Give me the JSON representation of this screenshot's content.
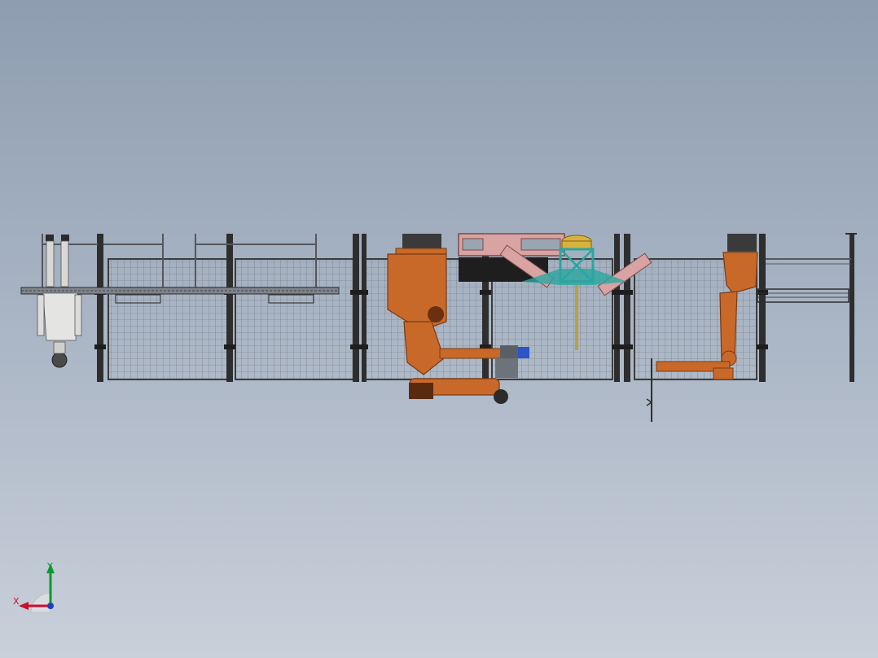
{
  "view": {
    "description_free": true,
    "background_top": "#8e9db0",
    "background_bottom": "#c9d0da"
  },
  "colors": {
    "fence": "#3c3c3c",
    "mesh": "#6b6f75",
    "robot": "#c8692a",
    "robot_dark": "#7a3a12",
    "table": "#2aa6a0",
    "pink": "#d9a3a3",
    "yellow": "#d8b23c",
    "blue": "#2a55c8"
  },
  "triad": {
    "x_label": "X",
    "y_label": "Y",
    "x_color": "#c8102e",
    "y_color": "#0a9a2a",
    "z_color": "#1f3fbf"
  }
}
